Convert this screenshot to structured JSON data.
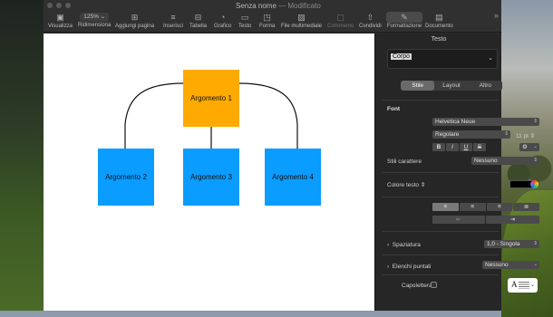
{
  "window": {
    "title": "Senza nome",
    "title_sep": "—",
    "title_status": "Modificato"
  },
  "toolbar": {
    "zoom_value": "125%",
    "items": [
      {
        "label": "Visualizza",
        "icon": "sidebar-icon"
      },
      {
        "label": "Ridimensiona",
        "icon": "zoom-icon"
      },
      {
        "label": "Aggiungi pagina",
        "icon": "add-page-icon"
      },
      {
        "label": "Inserisci",
        "icon": "insert-icon"
      },
      {
        "label": "Tabella",
        "icon": "table-icon"
      },
      {
        "label": "Grafico",
        "icon": "chart-icon"
      },
      {
        "label": "Testo",
        "icon": "text-icon"
      },
      {
        "label": "Forma",
        "icon": "shape-icon"
      },
      {
        "label": "File multimediale",
        "icon": "media-icon"
      },
      {
        "label": "Commento",
        "icon": "comment-icon"
      },
      {
        "label": "Condividi",
        "icon": "share-icon"
      },
      {
        "label": "Formattazione",
        "icon": "paintbrush-icon"
      },
      {
        "label": "Documento",
        "icon": "document-icon"
      }
    ]
  },
  "diagram": {
    "nodes": [
      {
        "label": "Argomento 1",
        "color": "#FFAA00"
      },
      {
        "label": "Argomento 2",
        "color": "#0A9CFF"
      },
      {
        "label": "Argomento 3",
        "color": "#0A9CFF"
      },
      {
        "label": "Argomento 4",
        "color": "#0A9CFF"
      }
    ]
  },
  "sidebar": {
    "title": "Testo",
    "paragraph_style": "Corpo",
    "tabs": [
      "Stile",
      "Layout",
      "Altro"
    ],
    "active_tab": "Stile",
    "font_header": "Font",
    "font_family": "Helvetica Neue",
    "font_weight": "Regolare",
    "font_size": "11 pt",
    "format_buttons": [
      "B",
      "I",
      "U",
      "S"
    ],
    "char_styles_label": "Stili carattere",
    "char_styles_value": "Nessuno",
    "text_color_label": "Colore testo",
    "text_color_value": "#000000",
    "spacing_label": "Spaziatura",
    "spacing_value": "1,0 - Singola",
    "bullets_label": "Elenchi puntati",
    "bullets_value": "Nessuno",
    "dropcap_label": "Capolettera",
    "dropcap_preview": "A"
  }
}
